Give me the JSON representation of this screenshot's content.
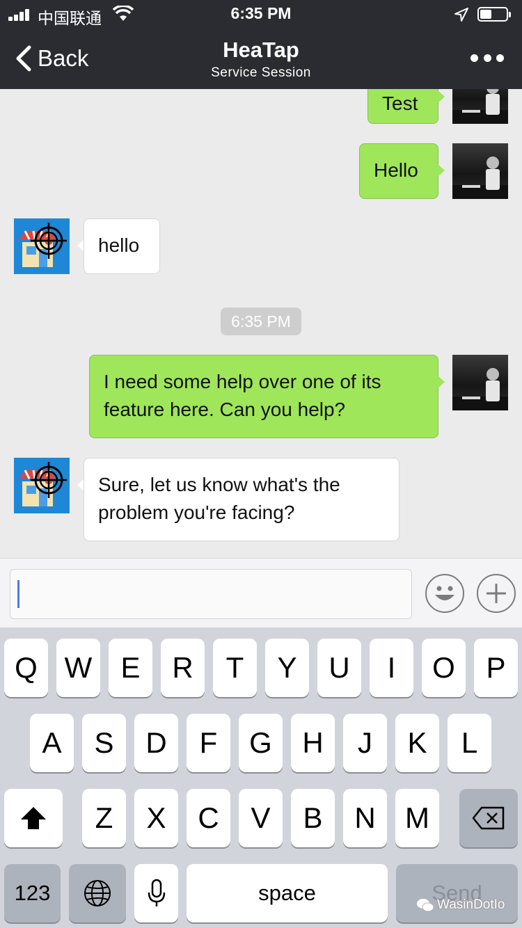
{
  "status_bar": {
    "carrier": "中国联通",
    "time": "6:35 PM"
  },
  "nav": {
    "back_label": "Back",
    "title": "HeaTap",
    "subtitle": "Service Session"
  },
  "messages": [
    {
      "side": "right",
      "text": "Test"
    },
    {
      "side": "right",
      "text": "Hello"
    },
    {
      "side": "left",
      "text": "hello"
    },
    {
      "side": "right",
      "text": "I need some help over one of its feature here. Can you help?"
    },
    {
      "side": "left",
      "text": "Sure, let us know what's the problem you're facing?"
    }
  ],
  "timestamp_divider": "6:35 PM",
  "input": {
    "value": ""
  },
  "keyboard": {
    "row1": [
      "Q",
      "W",
      "E",
      "R",
      "T",
      "Y",
      "U",
      "I",
      "O",
      "P"
    ],
    "row2": [
      "A",
      "S",
      "D",
      "F",
      "G",
      "H",
      "J",
      "K",
      "L"
    ],
    "row3": [
      "Z",
      "X",
      "C",
      "V",
      "B",
      "N",
      "M"
    ],
    "numbers_key": "123",
    "space_key": "space",
    "send_key": "Send"
  },
  "watermark": "WasinDotIo",
  "colors": {
    "outgoing_bubble": "#9fe65b",
    "incoming_bubble": "#ffffff",
    "nav_bar": "#2b2c31",
    "shop_avatar_bg": "#1e87d6"
  }
}
